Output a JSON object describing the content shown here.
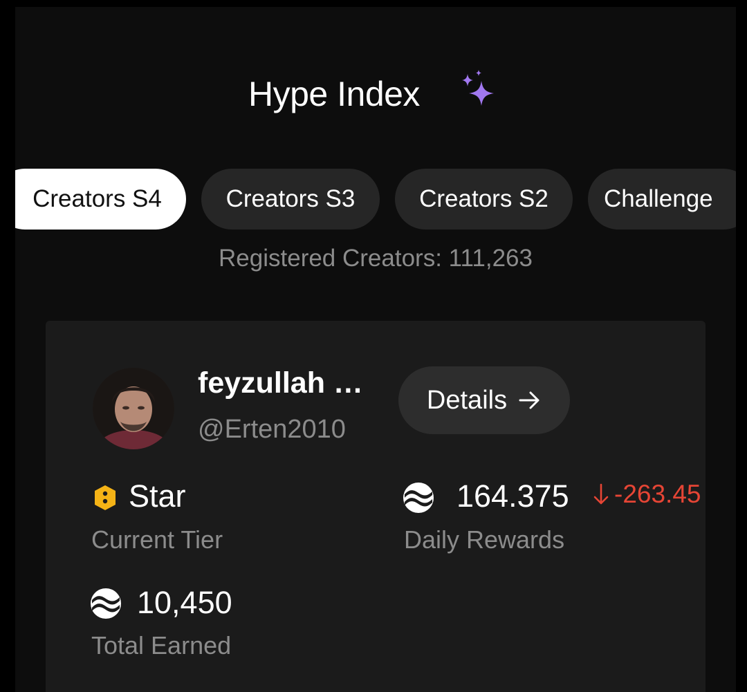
{
  "header": {
    "title": "Hype Index",
    "title_icon": "sparkles-icon",
    "sparkle_color": "#a178f0"
  },
  "tabs": [
    {
      "label": "Creators S4",
      "active": true
    },
    {
      "label": "Creators S3",
      "active": false
    },
    {
      "label": "Creators S2",
      "active": false
    },
    {
      "label": "Challenge",
      "active": false
    }
  ],
  "registered": {
    "text": "Registered Creators: 111,263"
  },
  "creator": {
    "name": "feyzullah …",
    "handle": "@Erten2010",
    "details_label": "Details",
    "details_icon": "arrow-right-icon",
    "tier": {
      "value": "Star",
      "label": "Current Tier",
      "icon": "star-tier-badge-icon",
      "icon_color": "#f5b316"
    },
    "daily_rewards": {
      "value": "164.375",
      "change": "-263.45",
      "change_icon": "arrow-down-icon",
      "change_color": "#e64535",
      "label": "Daily Rewards",
      "icon": "coin-icon"
    },
    "total_earned": {
      "value": "10,450",
      "label": "Total Earned",
      "icon": "coin-icon"
    }
  }
}
